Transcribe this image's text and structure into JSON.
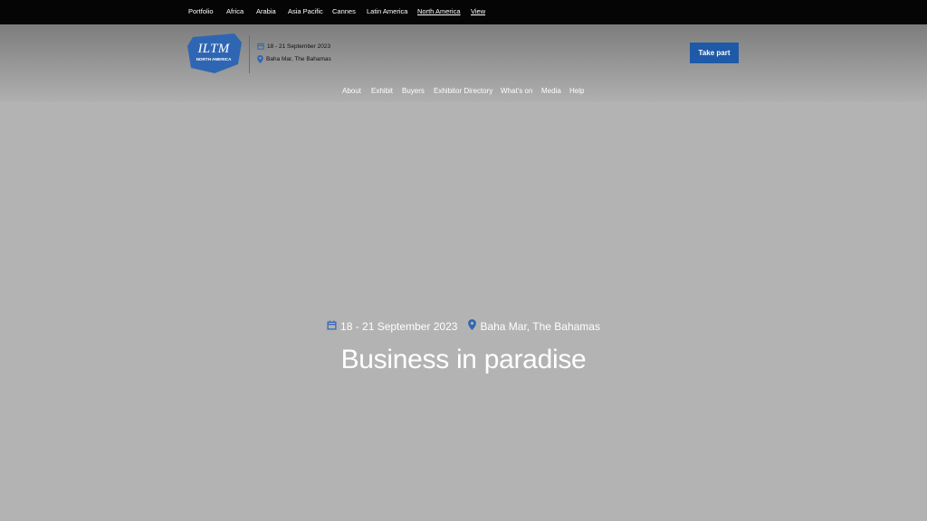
{
  "top_nav": {
    "items": [
      {
        "label": "Portfolio",
        "active": false
      },
      {
        "label": "Africa",
        "active": false
      },
      {
        "label": "Arabia",
        "active": false
      },
      {
        "label": "Asia Pacific",
        "active": false
      },
      {
        "label": "Cannes",
        "active": false
      },
      {
        "label": "Latin America",
        "active": false
      },
      {
        "label": "North America",
        "active": true
      },
      {
        "label": "View",
        "active": false
      }
    ]
  },
  "header": {
    "logo": {
      "main": "ILTM",
      "sub": "NORTH AMERICA",
      "color": "#2f66b3"
    },
    "date": "18 - 21 September 2023",
    "location": "Baha Mar, The Bahamas",
    "cta_label": "Take part",
    "cta_color": "#1e5aa8"
  },
  "main_nav": {
    "items": [
      "About",
      "Exhibit",
      "Buyers",
      "Exhibitor Directory",
      "What's on",
      "Media",
      "Help"
    ]
  },
  "hero": {
    "date": "18 - 21 September 2023",
    "location": "Baha Mar, The Bahamas",
    "title": "Business in paradise",
    "icon_color": "#2f66b3"
  }
}
